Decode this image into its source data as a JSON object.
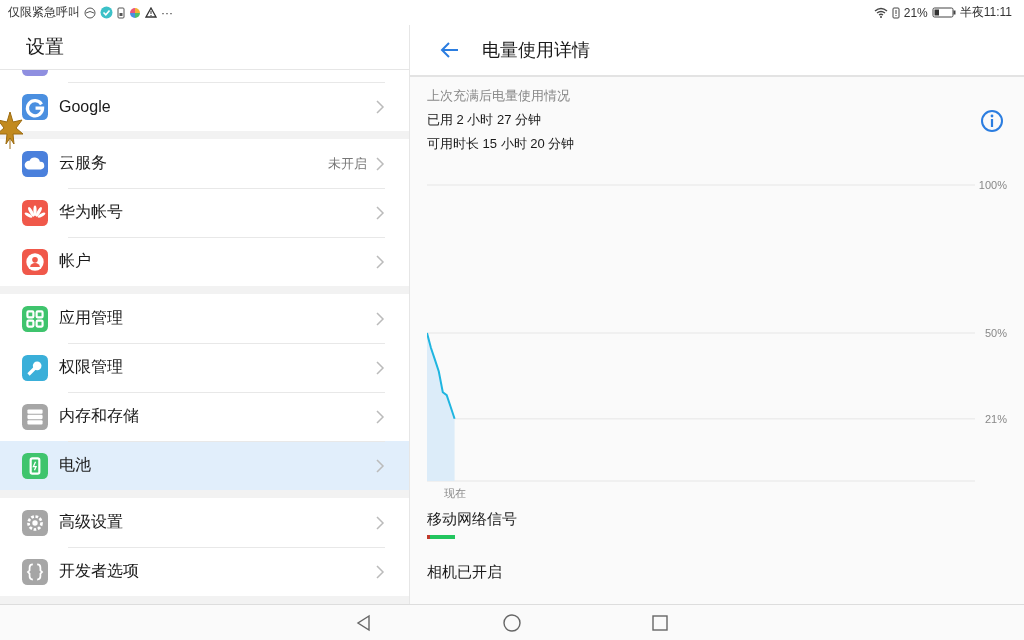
{
  "status_bar": {
    "carrier": "仅限紧急呼叫",
    "more": "···",
    "battery": "21%",
    "time": "半夜11:11"
  },
  "settings": {
    "title": "设置",
    "groups": [
      {
        "items": [
          {
            "label": "Google",
            "kind": "google",
            "selected": false
          }
        ]
      },
      {
        "items": [
          {
            "label": "云服务",
            "kind": "cloud",
            "value": "未开启",
            "selected": false
          },
          {
            "label": "华为帐号",
            "kind": "huawei",
            "selected": false
          },
          {
            "label": "帐户",
            "kind": "account",
            "selected": false
          }
        ]
      },
      {
        "items": [
          {
            "label": "应用管理",
            "kind": "apps",
            "selected": false
          },
          {
            "label": "权限管理",
            "kind": "key",
            "selected": false
          },
          {
            "label": "内存和存储",
            "kind": "storage",
            "selected": false
          },
          {
            "label": "电池",
            "kind": "battery",
            "selected": true
          }
        ]
      },
      {
        "items": [
          {
            "label": "高级设置",
            "kind": "gear",
            "selected": false
          },
          {
            "label": "开发者选项",
            "kind": "code",
            "selected": false
          }
        ]
      }
    ]
  },
  "detail": {
    "title": "电量使用详情",
    "caption": "上次充满后电量使用情况",
    "used": "已用 2 小时 27 分钟",
    "remaining": "可用时长 15 小时 20 分钟",
    "chart_data": {
      "type": "area",
      "categories": [
        null,
        null,
        null,
        null,
        null,
        null,
        null,
        "现在",
        null,
        null,
        null,
        null,
        null,
        null,
        null,
        null,
        null,
        null,
        null,
        null,
        null,
        null,
        null,
        null,
        null,
        null,
        null,
        null,
        null,
        null,
        null,
        null,
        null,
        null,
        null,
        null,
        null,
        null,
        null,
        null,
        null,
        null,
        null,
        null,
        null,
        null,
        null,
        null,
        null,
        null,
        null,
        null,
        null,
        null,
        null,
        null,
        null,
        null,
        null,
        null,
        null,
        null,
        null,
        null,
        null,
        null,
        null,
        null,
        null,
        null,
        null,
        null,
        null,
        null,
        null,
        null,
        null,
        null,
        null,
        null,
        null,
        null,
        null,
        null,
        null,
        null,
        null,
        null,
        null,
        null,
        null,
        null,
        null,
        null,
        null,
        null,
        null,
        null,
        null,
        null,
        null,
        null,
        null,
        null,
        null,
        null,
        null,
        null,
        null,
        null,
        null,
        null,
        null,
        null,
        null,
        null,
        null,
        null,
        null,
        null,
        null,
        null,
        null,
        null,
        null,
        null,
        null,
        null,
        null,
        null,
        null,
        null,
        null,
        null,
        null,
        null,
        null,
        null,
        null,
        null
      ],
      "series": [
        {
          "color": "#1fb5e0",
          "values": [
            50,
            45,
            41,
            37,
            30,
            29,
            25,
            21,
            null,
            null,
            null,
            null,
            null,
            null,
            null,
            null,
            null,
            null,
            null,
            null,
            null,
            null,
            null,
            null,
            null,
            null,
            null,
            null,
            null,
            null,
            null,
            null,
            null,
            null,
            null,
            null,
            null,
            null,
            null,
            null,
            null,
            null,
            null,
            null,
            null,
            null,
            null,
            null,
            null,
            null,
            null,
            null,
            null,
            null,
            null,
            null,
            null,
            null,
            null,
            null,
            null,
            null,
            null,
            null,
            null,
            null,
            null,
            null,
            null,
            null,
            null,
            null,
            null,
            null,
            null,
            null,
            null,
            null,
            null,
            null,
            null,
            null,
            null,
            null,
            null,
            null,
            null,
            null,
            null,
            null,
            null,
            null,
            null,
            null,
            null,
            null,
            null,
            null,
            null,
            null,
            null,
            null,
            null,
            null,
            null,
            null,
            null,
            null,
            null,
            null,
            null,
            null,
            null,
            null,
            null,
            null,
            null,
            null,
            null,
            null,
            null,
            null,
            null,
            null,
            null,
            null,
            null,
            null,
            null,
            null,
            null,
            null,
            null,
            null,
            null,
            null,
            null,
            null,
            null,
            null
          ]
        }
      ],
      "ylim": [
        0,
        100
      ],
      "yticks": [
        {
          "value": 100,
          "label": "100%"
        },
        {
          "value": 50,
          "label": "50%"
        },
        {
          "value": 21,
          "label": "21%"
        }
      ]
    },
    "events": [
      {
        "label": "移动网络信号",
        "kind": "signal"
      },
      {
        "label": "相机已开启",
        "kind": "text"
      }
    ]
  }
}
